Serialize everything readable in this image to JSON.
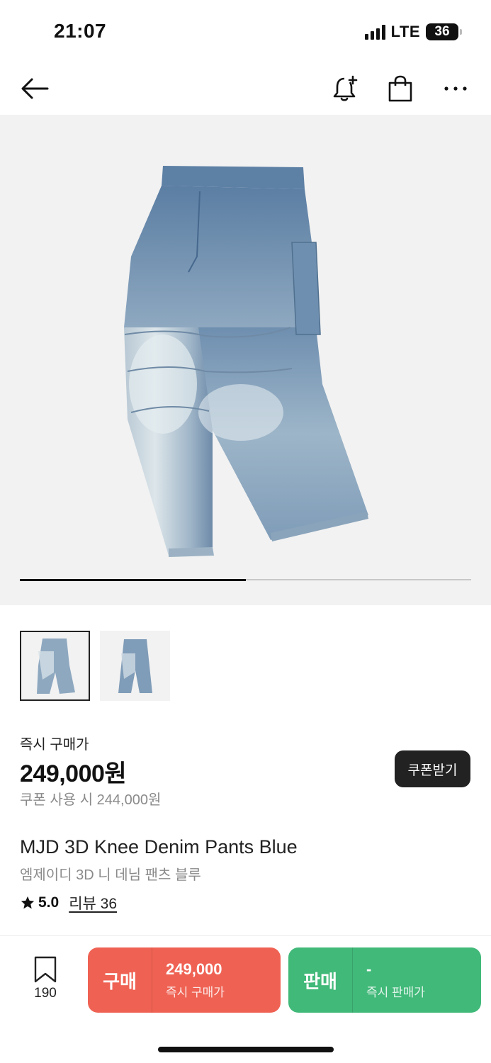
{
  "status_bar": {
    "time": "21:07",
    "network": "LTE",
    "battery": "36"
  },
  "nav": {
    "icons": [
      "back-arrow-icon",
      "bell-plus-icon",
      "shopping-bag-icon",
      "more-icon"
    ]
  },
  "gallery": {
    "image": "blue-denim-pants-photo",
    "page_index": 1,
    "page_count": 2,
    "progress": 0.5
  },
  "thumbnails": [
    {
      "image": "denim-pants-front-thumb",
      "selected": true
    },
    {
      "image": "denim-pants-thumb-2",
      "selected": false
    }
  ],
  "price_section": {
    "label": "즉시 구매가",
    "price": "249,000원",
    "coupon_note": "쿠폰 사용 시 244,000원",
    "coupon_button": "쿠폰받기"
  },
  "product": {
    "name_en": "MJD 3D Knee Denim Pants Blue",
    "name_ko": "엠제이디 3D 니 데님 팬츠 블루",
    "rating": "5.0",
    "review": "리뷰 36"
  },
  "bottom_bar": {
    "bookmark_count": "190",
    "buy": {
      "label": "구매",
      "price": "249,000",
      "sub": "즉시 구매가",
      "color": "#ef6253"
    },
    "sell": {
      "label": "판매",
      "price": "-",
      "sub": "즉시 판매가",
      "color": "#41b979"
    }
  }
}
